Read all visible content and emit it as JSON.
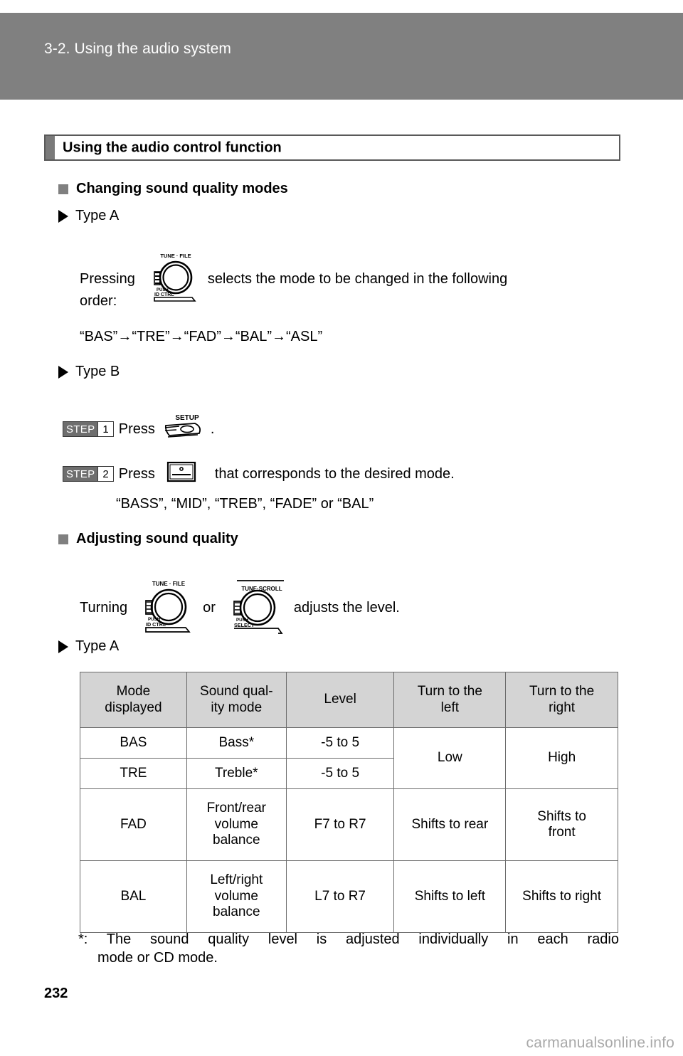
{
  "header": {
    "chapter_title": "3-2. Using the audio system"
  },
  "section": {
    "title": "Using the audio control function"
  },
  "subsections": {
    "changing_modes": "Changing sound quality modes",
    "adjusting_quality": "Adjusting sound quality"
  },
  "type_labels": {
    "type_a_1": "Type A",
    "type_b": "Type B",
    "type_a_2": "Type A"
  },
  "type_a_instructions": {
    "pressing_prefix": "Pressing",
    "pressing_suffix": "selects the mode to be changed in the following",
    "order_word": "order:",
    "order_sequence": "“BAS”→“TRE”→“FAD”→“BAL”→“ASL”"
  },
  "type_b_steps": [
    {
      "step_word": "STEP",
      "step_number": "1",
      "text_before": "Press",
      "icon": "setup-button-icon",
      "text_after": "."
    },
    {
      "step_word": "STEP",
      "step_number": "2",
      "text_before": "Press",
      "icon": "preset-button-icon",
      "text_after": "that corresponds to the desired mode."
    }
  ],
  "type_b_modes": "“BASS”, “MID”, “TREB”, “FADE” or “BAL”",
  "adjusting": {
    "turning_prefix": "Turning",
    "or_word": "or",
    "suffix": "adjusts the level."
  },
  "knob_icons": {
    "tune_file": {
      "top_label": "TUNE · FILE",
      "bottom_label_1": "PUSH",
      "bottom_label_2": "ID CTRL"
    },
    "tune_scroll": {
      "top_label": "TUNE·SCROLL",
      "bottom_label_1": "PUSH",
      "bottom_label_2": "SELECT"
    },
    "setup_button": {
      "top_label": "SETUP"
    }
  },
  "table": {
    "headers": [
      "Mode displayed",
      "Sound qual-ity mode",
      "Level",
      "Turn to the left",
      "Turn to the right"
    ],
    "headers_lines": {
      "h0_l1": "Mode",
      "h0_l2": "displayed",
      "h1_l1": "Sound qual-",
      "h1_l2": "ity mode",
      "h2_l1": "Level",
      "h3_l1": "Turn to the",
      "h3_l2": "left",
      "h4_l1": "Turn to the",
      "h4_l2": "right"
    },
    "rows": [
      {
        "mode": "BAS",
        "quality": "Bass*",
        "level": "-5 to 5",
        "left": "Low",
        "right": "High"
      },
      {
        "mode": "TRE",
        "quality": "Treble*",
        "level": "-5 to 5",
        "left": "",
        "right": ""
      },
      {
        "mode": "FAD",
        "quality_l1": "Front/rear",
        "quality_l2": "volume",
        "quality_l3": "balance",
        "level": "F7 to R7",
        "left": "Shifts to rear",
        "right_l1": "Shifts to",
        "right_l2": "front"
      },
      {
        "mode": "BAL",
        "quality_l1": "Left/right",
        "quality_l2": "volume",
        "quality_l3": "balance",
        "level": "L7 to R7",
        "left": "Shifts to left",
        "right_l1": "Shifts to right",
        "right_l2": ""
      }
    ]
  },
  "footnote": {
    "line1": "*: The sound quality level is adjusted individually in each radio",
    "line2": "mode or CD mode."
  },
  "page_number": "232",
  "watermark": "carmanualsonline.info",
  "colors": {
    "header_band": "#808080",
    "section_bar": "#7a7a7a",
    "table_header_bg": "#d4d4d4",
    "step_badge_bg": "#6e6e6e",
    "bullet_gray": "#808080"
  }
}
